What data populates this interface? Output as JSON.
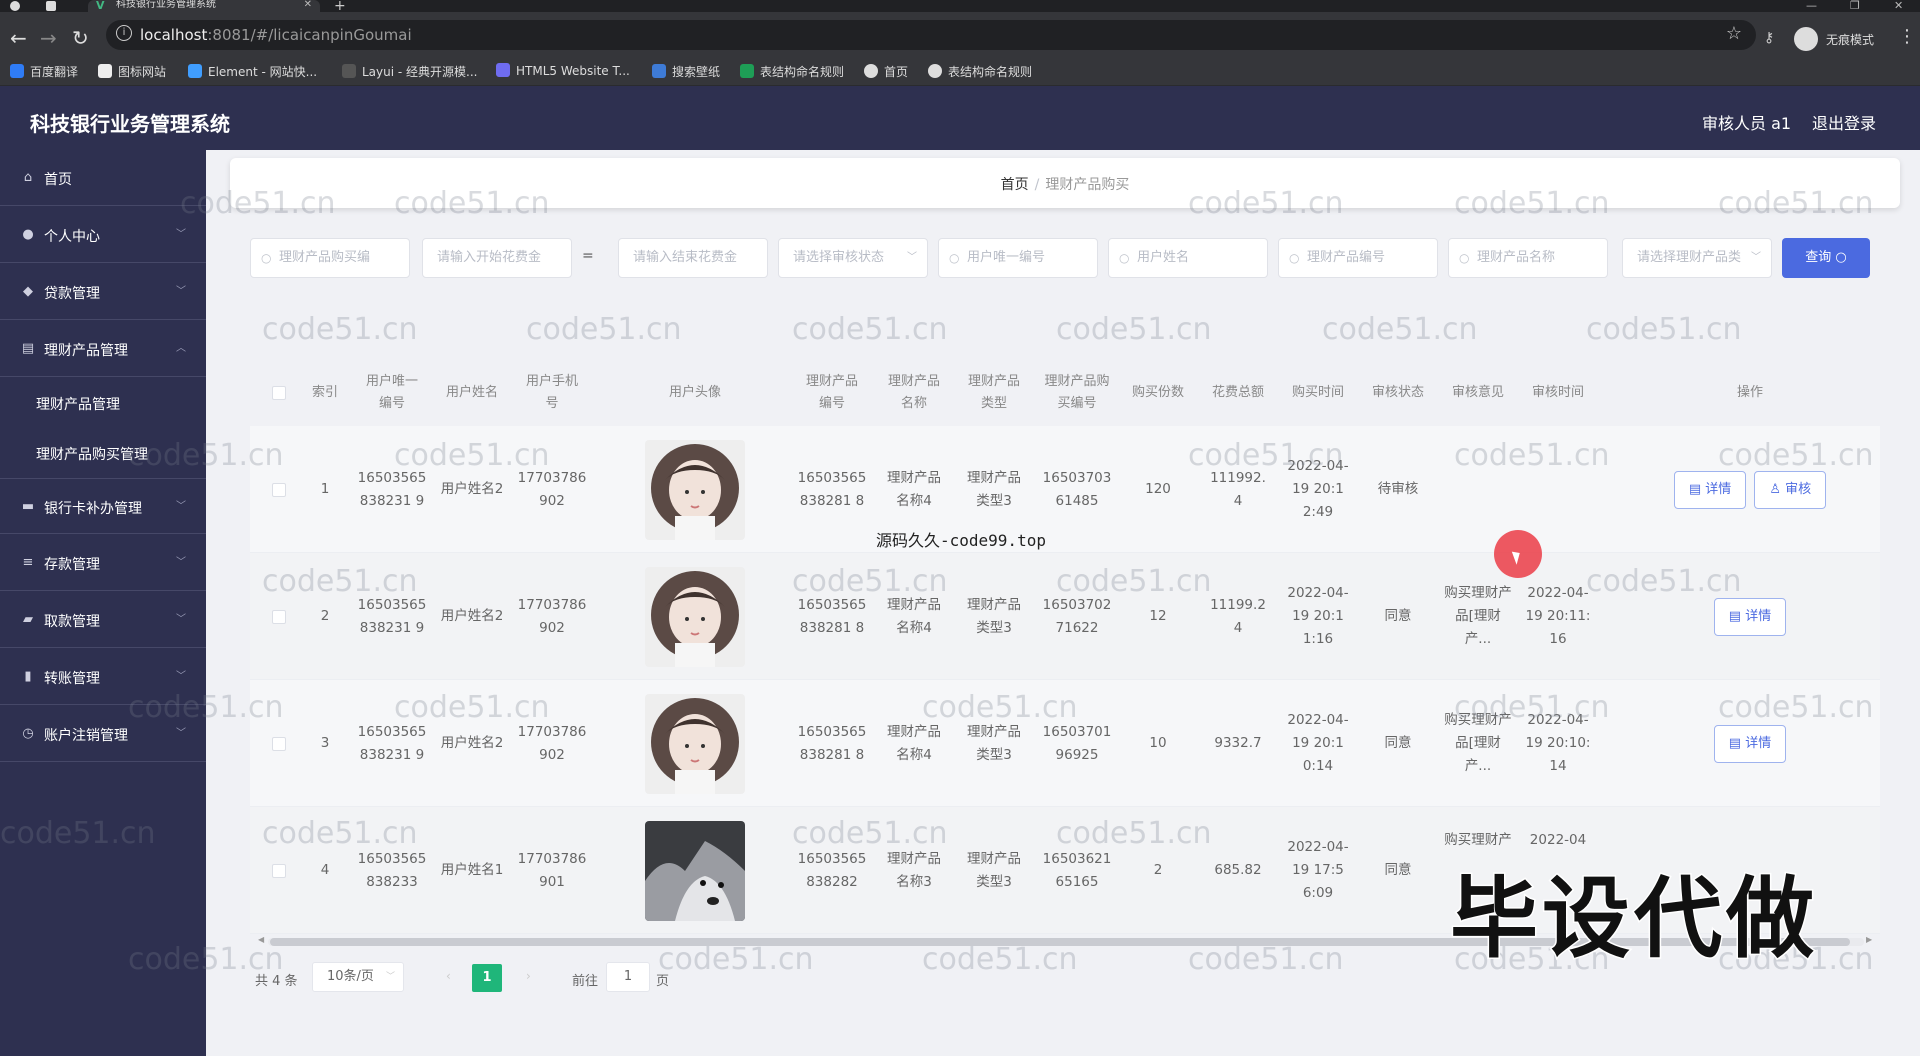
{
  "browser": {
    "tab_title": "科技银行业务管理系统",
    "url_host": "localhost",
    "url_rest": ":8081/#/licaicanpinGoumai",
    "incognito_label": "无痕模式",
    "bookmarks": [
      "百度翻译",
      "图标网站",
      "Element - 网站快...",
      "Layui - 经典开源模...",
      "HTML5 Website T...",
      "搜索壁纸",
      "表结构命名规则",
      "首页",
      "表结构命名规则"
    ]
  },
  "header": {
    "title": "科技银行业务管理系统",
    "user": "审核人员 a1",
    "logout": "退出登录"
  },
  "sidebar": {
    "items": [
      {
        "label": "首页",
        "icon": "home-icon"
      },
      {
        "label": "个人中心",
        "icon": "user-icon"
      },
      {
        "label": "贷款管理",
        "icon": "loan-icon"
      },
      {
        "label": "理财产品管理",
        "icon": "finance-icon"
      },
      {
        "label": "理财产品管理",
        "icon": ""
      },
      {
        "label": "理财产品购买管理",
        "icon": ""
      },
      {
        "label": "银行卡补办管理",
        "icon": "card-icon"
      },
      {
        "label": "存款管理",
        "icon": "deposit-icon"
      },
      {
        "label": "取款管理",
        "icon": "withdraw-icon"
      },
      {
        "label": "转账管理",
        "icon": "transfer-icon"
      },
      {
        "label": "账户注销管理",
        "icon": "account-icon"
      }
    ]
  },
  "breadcrumb": {
    "home": "首页",
    "current": "理财产品购买"
  },
  "search": {
    "purchase_no": "理财产品购买编",
    "start_cost": "请输入开始花费金",
    "range_sep": "=",
    "end_cost": "请输入结束花费金",
    "audit_status": "请选择审核状态",
    "user_no": "用户唯一编号",
    "user_name": "用户姓名",
    "product_no": "理财产品编号",
    "product_name": "理财产品名称",
    "product_type": "请选择理财产品类",
    "query_button": "查询"
  },
  "table": {
    "headers": [
      "索引",
      "用户唯一编号",
      "用户姓名",
      "用户手机号",
      "用户头像",
      "理财产品编号",
      "理财产品名称",
      "理财产品类型",
      "理财产品购买编号",
      "购买份数",
      "花费总额",
      "购买时间",
      "审核状态",
      "审核意见",
      "审核时间",
      "操作"
    ],
    "rows": [
      {
        "index": "1",
        "user_no": "16503565838231 9",
        "user_name": "用户姓名2",
        "phone": "17703786902",
        "avatar": "girl",
        "product_no": "16503565838281 8",
        "product_name": "理财产品名称4",
        "product_type": "理财产品类型3",
        "purchase_no": "1650370361485",
        "count": "120",
        "total": "111992.4",
        "buy_time": "2022-04-19 20:12:49",
        "status": "待审核",
        "opinion": "",
        "audit_time": "",
        "ops": [
          "详情",
          "审核"
        ]
      },
      {
        "index": "2",
        "user_no": "16503565838231 9",
        "user_name": "用户姓名2",
        "phone": "17703786902",
        "avatar": "girl",
        "product_no": "16503565838281 8",
        "product_name": "理财产品名称4",
        "product_type": "理财产品类型3",
        "purchase_no": "1650370271622",
        "count": "12",
        "total": "11199.24",
        "buy_time": "2022-04-19 20:11:16",
        "status": "同意",
        "opinion": "购买理财产品[理财产...",
        "audit_time": "2022-04-19 20:11:16",
        "ops": [
          "详情"
        ]
      },
      {
        "index": "3",
        "user_no": "16503565838231 9",
        "user_name": "用户姓名2",
        "phone": "17703786902",
        "avatar": "girl",
        "product_no": "16503565838281 8",
        "product_name": "理财产品名称4",
        "product_type": "理财产品类型3",
        "purchase_no": "1650370196925",
        "count": "10",
        "total": "9332.7",
        "buy_time": "2022-04-19 20:10:14",
        "status": "同意",
        "opinion": "购买理财产品[理财产...",
        "audit_time": "2022-04-19 20:10:14",
        "ops": [
          "详情"
        ]
      },
      {
        "index": "4",
        "user_no": "16503565838233",
        "user_name": "用户姓名1",
        "phone": "17703786901",
        "avatar": "husky",
        "product_no": "16503565838282",
        "product_name": "理财产品名称3",
        "product_type": "理财产品类型3",
        "purchase_no": "1650362165165",
        "count": "2",
        "total": "685.82",
        "buy_time": "2022-04-19 17:56:09",
        "status": "同意",
        "opinion": "购买理财产",
        "audit_time": "2022-04",
        "ops": []
      }
    ]
  },
  "pagination": {
    "total": "共 4 条",
    "page_size": "10条/页",
    "current_page": "1",
    "goto_label": "前往",
    "goto_value": "1",
    "page_suffix": "页"
  },
  "overlays": {
    "watermark": "code51.cn",
    "center_mark": "源码久久-code99.top",
    "big_mark": "毕设代做"
  },
  "colors": {
    "header_bg": "#2e3050",
    "accent": "#4b6ae0",
    "page_active": "#1fb67a"
  }
}
